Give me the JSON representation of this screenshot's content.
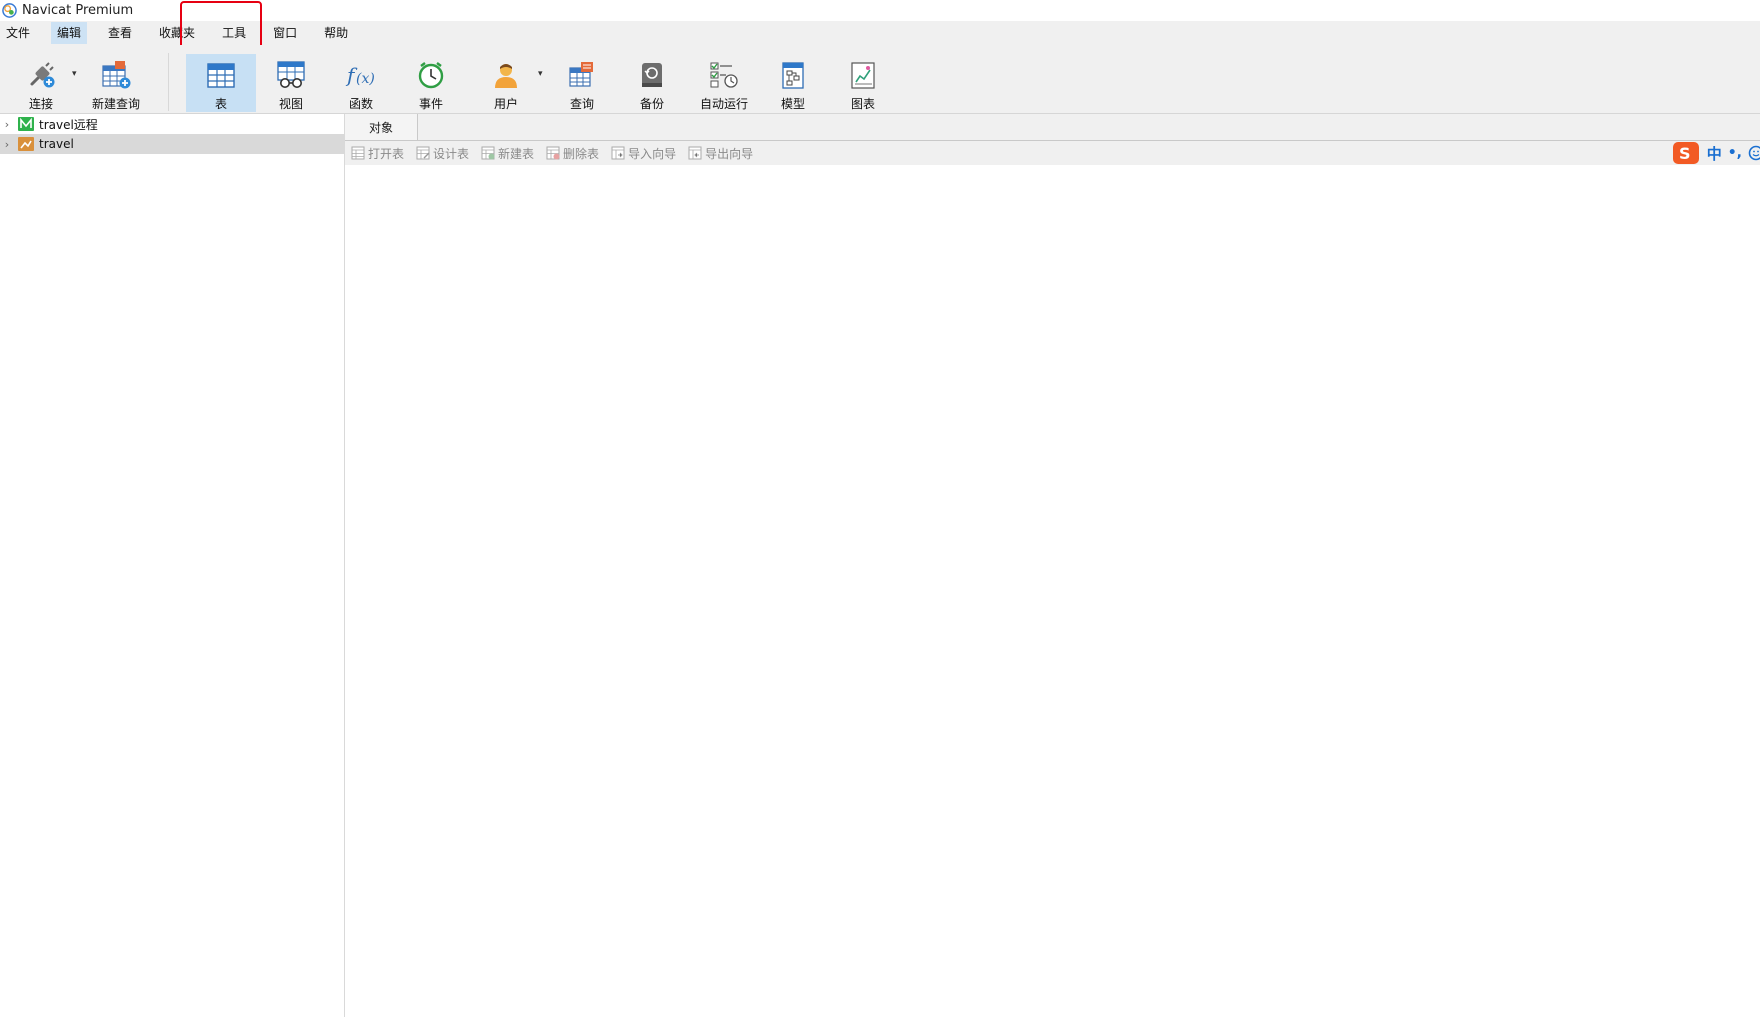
{
  "window": {
    "title": "Navicat Premium"
  },
  "menubar": {
    "items": [
      {
        "label": "文件"
      },
      {
        "label": "编辑"
      },
      {
        "label": "查看"
      },
      {
        "label": "收藏夹"
      },
      {
        "label": "工具"
      },
      {
        "label": "窗口"
      },
      {
        "label": "帮助"
      }
    ],
    "active_index": 1
  },
  "toolbar": {
    "connect": "连接",
    "new_query": "新建查询",
    "table": "表",
    "view": "视图",
    "function": "函数",
    "event": "事件",
    "user": "用户",
    "query": "查询",
    "backup": "备份",
    "autorun": "自动运行",
    "model": "模型",
    "chart": "图表",
    "dropdown_glyph": "▾"
  },
  "tree": {
    "chevron": "›",
    "items": [
      {
        "label": "travel远程",
        "icon": "remote-db-icon",
        "color": "#2fb24c"
      },
      {
        "label": "travel",
        "icon": "local-db-icon",
        "color": "#d9903b"
      }
    ]
  },
  "tabs": {
    "objects": "对象"
  },
  "object_toolbar": {
    "open_table": "打开表",
    "design_table": "设计表",
    "new_table": "新建表",
    "delete_table": "删除表",
    "import_wizard": "导入向导",
    "export_wizard": "导出向导"
  },
  "ime": {
    "lang": "中",
    "punct": "•,"
  },
  "colors": {
    "accent": "#cde2f4",
    "highlight": "#e60012"
  }
}
